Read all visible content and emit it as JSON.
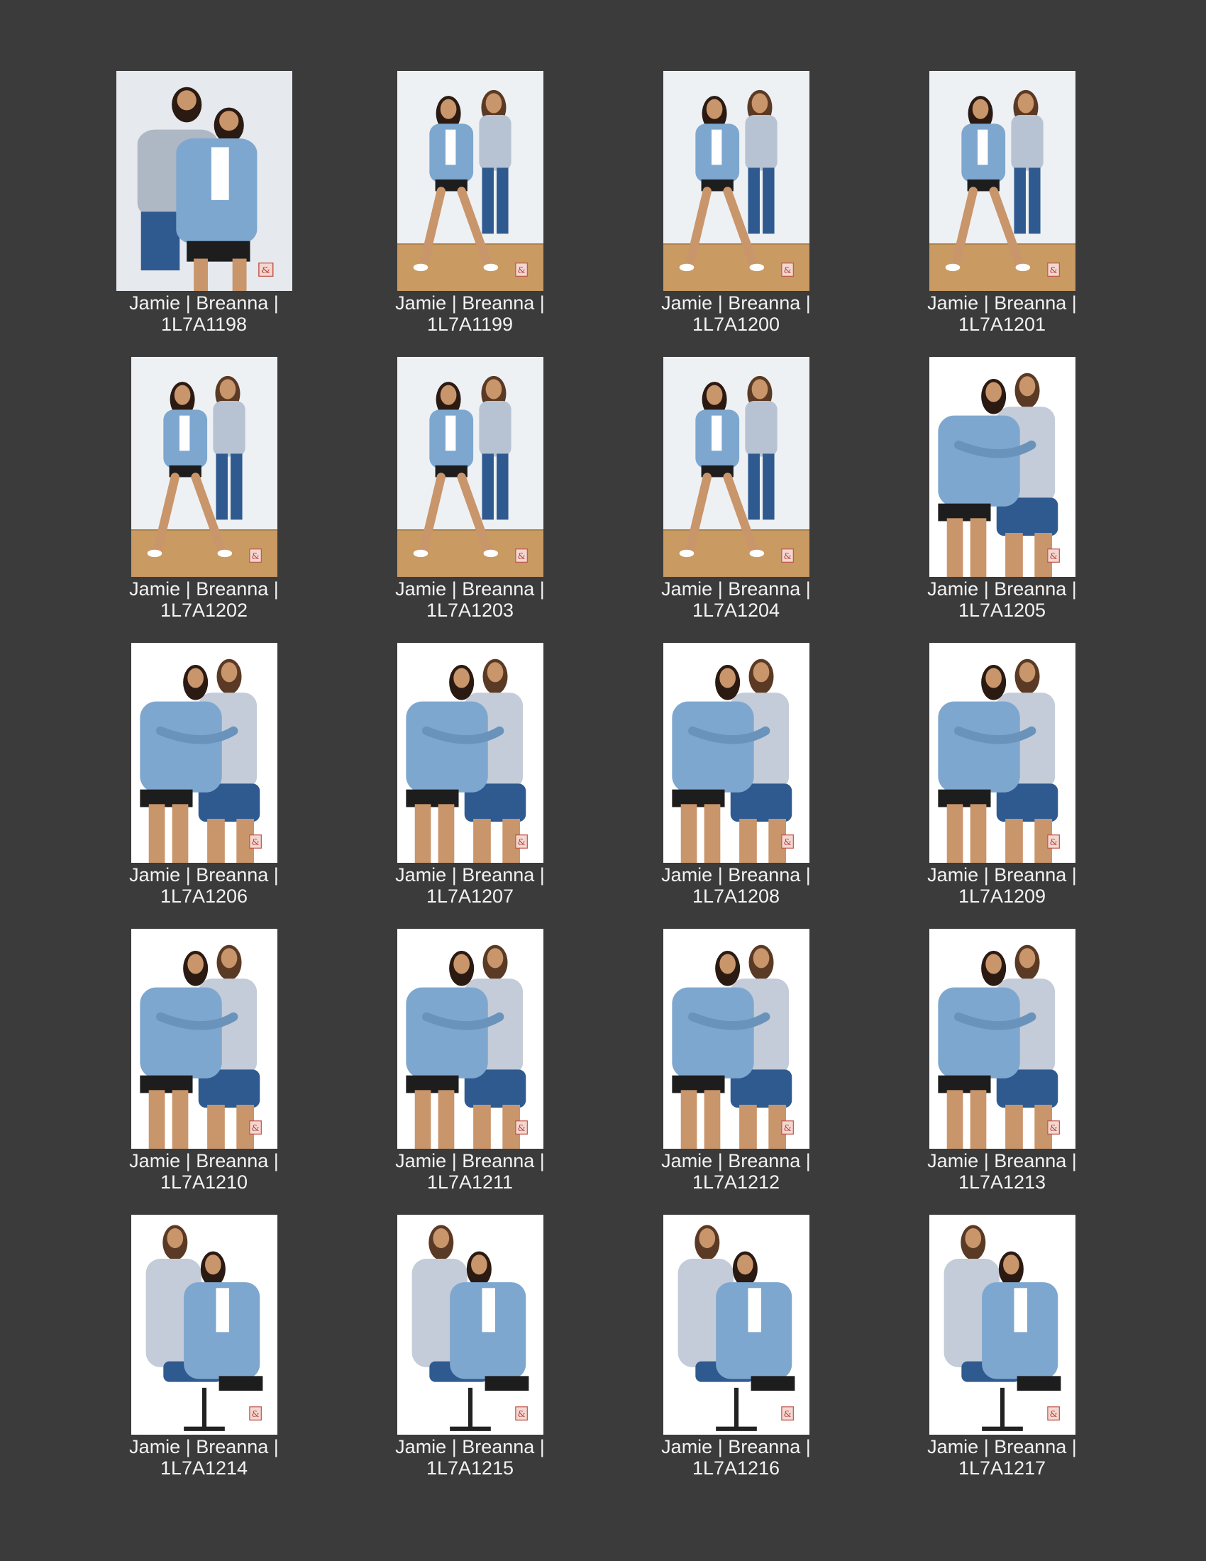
{
  "sheet": {
    "background": "#3b3b3b",
    "caption_color": "#f2f2f2",
    "thumbnails": [
      {
        "line1": "Jamie  |  Breanna  |",
        "line2": "1L7A1198",
        "scene": "grey-hug"
      },
      {
        "line1": "Jamie  |  Breanna  |",
        "line2": "1L7A1199",
        "scene": "standing"
      },
      {
        "line1": "Jamie  |  Breanna  |",
        "line2": "1L7A1200",
        "scene": "standing"
      },
      {
        "line1": "Jamie  |  Breanna  |",
        "line2": "1L7A1201",
        "scene": "standing"
      },
      {
        "line1": "Jamie  |  Breanna  |",
        "line2": "1L7A1202",
        "scene": "standing"
      },
      {
        "line1": "Jamie  |  Breanna  |",
        "line2": "1L7A1203",
        "scene": "standing"
      },
      {
        "line1": "Jamie  |  Breanna  |",
        "line2": "1L7A1204",
        "scene": "standing"
      },
      {
        "line1": "Jamie  |  Breanna  |",
        "line2": "1L7A1205",
        "scene": "seated-hug"
      },
      {
        "line1": "Jamie  |  Breanna  |",
        "line2": "1L7A1206",
        "scene": "seated-hug"
      },
      {
        "line1": "Jamie  |  Breanna  |",
        "line2": "1L7A1207",
        "scene": "seated-hug"
      },
      {
        "line1": "Jamie  |  Breanna  |",
        "line2": "1L7A1208",
        "scene": "seated-hug"
      },
      {
        "line1": "Jamie  |  Breanna  |",
        "line2": "1L7A1209",
        "scene": "seated-hug"
      },
      {
        "line1": "Jamie  |  Breanna  |",
        "line2": "1L7A1210",
        "scene": "seated-hug"
      },
      {
        "line1": "Jamie  |  Breanna  |",
        "line2": "1L7A1211",
        "scene": "seated-hug"
      },
      {
        "line1": "Jamie  |  Breanna  |",
        "line2": "1L7A1212",
        "scene": "seated-hug"
      },
      {
        "line1": "Jamie  |  Breanna  |",
        "line2": "1L7A1213",
        "scene": "seated-hug"
      },
      {
        "line1": "Jamie  |  Breanna  |",
        "line2": "1L7A1214",
        "scene": "seated-lean"
      },
      {
        "line1": "Jamie  |  Breanna  |",
        "line2": "1L7A1215",
        "scene": "seated-lean"
      },
      {
        "line1": "Jamie  |  Breanna  |",
        "line2": "1L7A1216",
        "scene": "seated-lean"
      },
      {
        "line1": "Jamie  |  Breanna  |",
        "line2": "1L7A1217",
        "scene": "seated-lean"
      }
    ]
  }
}
